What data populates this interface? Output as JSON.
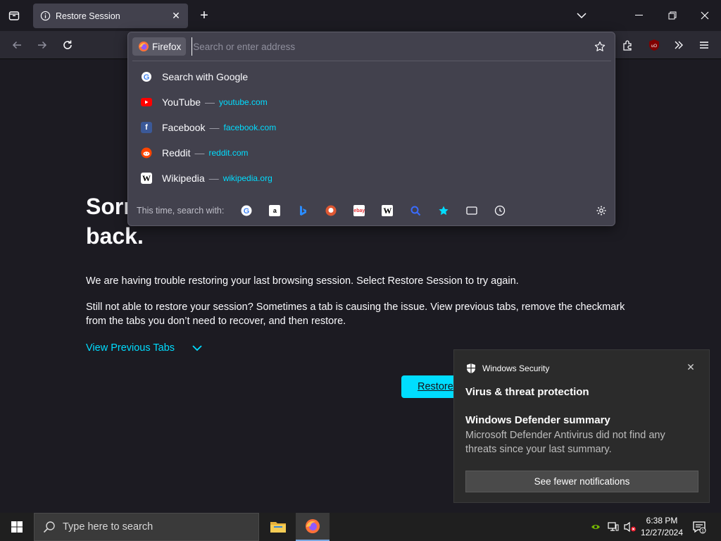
{
  "tab": {
    "title": "Restore Session",
    "close": "✕"
  },
  "tabstrip": {
    "new_tab": "+",
    "list_all": "⌄",
    "minimize": "—",
    "maximize": "❐",
    "close": "✕"
  },
  "urlbar": {
    "identity_label": "Firefox",
    "placeholder": "Search or enter address",
    "results": [
      {
        "label": "Search with Google",
        "icon": "google-icon"
      },
      {
        "label": "YouTube",
        "url": "youtube.com",
        "icon": "youtube-icon"
      },
      {
        "label": "Facebook",
        "url": "facebook.com",
        "icon": "facebook-icon"
      },
      {
        "label": "Reddit",
        "url": "reddit.com",
        "icon": "reddit-icon"
      },
      {
        "label": "Wikipedia",
        "url": "wikipedia.org",
        "icon": "wikipedia-icon"
      }
    ],
    "separator": "—",
    "oneoff_label": "This time, search with:",
    "engines": [
      "google",
      "amazon",
      "bing",
      "duckduckgo",
      "ebay",
      "wikipedia",
      "search-history",
      "bookmarks",
      "tabs",
      "history"
    ]
  },
  "page": {
    "heading_line1": "Sorr",
    "heading_line2": "back.",
    "p1": "We are having trouble restoring your last browsing session. Select Restore Session to try again.",
    "p2": "Still not able to restore your session? Sometimes a tab is causing the issue. View previous tabs, remove the checkmark from the tabs you don’t need to recover, and then restore.",
    "view_previous": "View Previous Tabs",
    "restore_button": "Restore"
  },
  "toast": {
    "app": "Windows Security",
    "title": "Virus & threat protection",
    "subtitle": "Windows Defender summary",
    "body": "Microsoft Defender Antivirus did not find any threats since your last summary.",
    "button": "See fewer notifications",
    "close": "✕"
  },
  "taskbar": {
    "search_placeholder": "Type here to search",
    "time": "6:38 PM",
    "date": "12/27/2024",
    "notification_count": "1"
  },
  "colors": {
    "accent": "#00ddff",
    "panel": "#42414d",
    "page_bg": "#1c1b22"
  }
}
